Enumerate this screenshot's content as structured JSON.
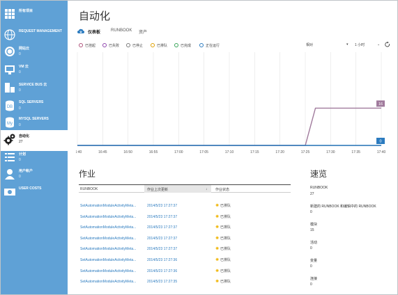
{
  "sidebar": {
    "items": [
      {
        "label": "所有项目",
        "count": "",
        "icon": "grid-icon"
      },
      {
        "label": "REQUEST MANAGEMENT",
        "count": "",
        "icon": "globe-icon"
      },
      {
        "label": "网站云",
        "count": "0",
        "icon": "website-icon"
      },
      {
        "label": "VM 云",
        "count": "0",
        "icon": "monitor-icon"
      },
      {
        "label": "SERVICE BUS 云",
        "count": "0",
        "icon": "service-bus-icon"
      },
      {
        "label": "SQL SERVERS",
        "count": "0",
        "icon": "database-icon"
      },
      {
        "label": "MYSQL SERVERS",
        "count": "0",
        "icon": "mysql-icon"
      },
      {
        "label": "自动化",
        "count": "27",
        "icon": "gear-icon"
      },
      {
        "label": "计划",
        "count": "0",
        "icon": "list-icon"
      },
      {
        "label": "用户帐户",
        "count": "0",
        "icon": "user-icon"
      },
      {
        "label": "USER COSTS",
        "count": "",
        "icon": "costs-icon"
      }
    ]
  },
  "page": {
    "title": "自动化"
  },
  "tabs": [
    {
      "label": "仪表板"
    },
    {
      "label": "RUNBOOK"
    },
    {
      "label": "资产"
    }
  ],
  "legend": [
    {
      "label": "已挂起",
      "color": "#b0527a"
    },
    {
      "label": "已失败",
      "color": "#8e44ad"
    },
    {
      "label": "已停止",
      "color": "#7a7a7a"
    },
    {
      "label": "已排队",
      "color": "#e0a000"
    },
    {
      "label": "已完成",
      "color": "#3aa55a"
    },
    {
      "label": "正在运行",
      "color": "#2b7bbf"
    }
  ],
  "controls": {
    "relative": "相对",
    "range": "1 小时"
  },
  "chart_data": {
    "type": "line",
    "categories": [
      "16:40",
      "16:45",
      "16:50",
      "16:55",
      "17:00",
      "17:05",
      "17:10",
      "17:15",
      "17:20",
      "17:25",
      "17:30",
      "17:35",
      "17:40"
    ],
    "series": [
      {
        "color": "#a07a9c",
        "points": [
          [
            "16:40",
            0
          ],
          [
            "17:25",
            0
          ],
          [
            "17:27",
            16
          ],
          [
            "17:40",
            16
          ]
        ],
        "end_label": "16"
      },
      {
        "color": "#2b7bbf",
        "points": [
          [
            "16:40",
            0
          ],
          [
            "17:40",
            0
          ]
        ],
        "end_label": "0"
      }
    ],
    "ylim": [
      0,
      40
    ],
    "grid": true
  },
  "jobs": {
    "title": "作业",
    "columns": [
      "RUNBOOK",
      "作业上次更新",
      "作业状态"
    ],
    "rows": [
      {
        "runbook": "SetAutomationModuleActivityMeta...",
        "updated": "2014/5/23 17:27:37",
        "status": "已排队"
      },
      {
        "runbook": "SetAutomationModuleActivityMeta...",
        "updated": "2014/5/23 17:27:37",
        "status": "已排队"
      },
      {
        "runbook": "SetAutomationModuleActivityMeta...",
        "updated": "2014/5/23 17:27:37",
        "status": "已排队"
      },
      {
        "runbook": "SetAutomationModuleActivityMeta...",
        "updated": "2014/5/23 17:27:37",
        "status": "已排队"
      },
      {
        "runbook": "SetAutomationModuleActivityMeta...",
        "updated": "2014/5/23 17:27:37",
        "status": "已排队"
      },
      {
        "runbook": "SetAutomationModuleActivityMeta...",
        "updated": "2014/5/23 17:27:36",
        "status": "已排队"
      },
      {
        "runbook": "SetAutomationModuleActivityMeta...",
        "updated": "2014/5/23 17:27:36",
        "status": "已排队"
      },
      {
        "runbook": "SetAutomationModuleActivityMeta...",
        "updated": "2014/5/23 17:27:35",
        "status": "已排队"
      }
    ]
  },
  "overview": {
    "title": "速览",
    "stats": [
      {
        "label": "RUNBOOK",
        "value": "27"
      },
      {
        "label": "新建的 RUNBOOK 和编辑中的 RUNBOOK",
        "value": "0"
      },
      {
        "label": "模块",
        "value": "15"
      },
      {
        "label": "活动",
        "value": "0"
      },
      {
        "label": "变量",
        "value": "0"
      },
      {
        "label": "连接",
        "value": "0"
      }
    ]
  }
}
